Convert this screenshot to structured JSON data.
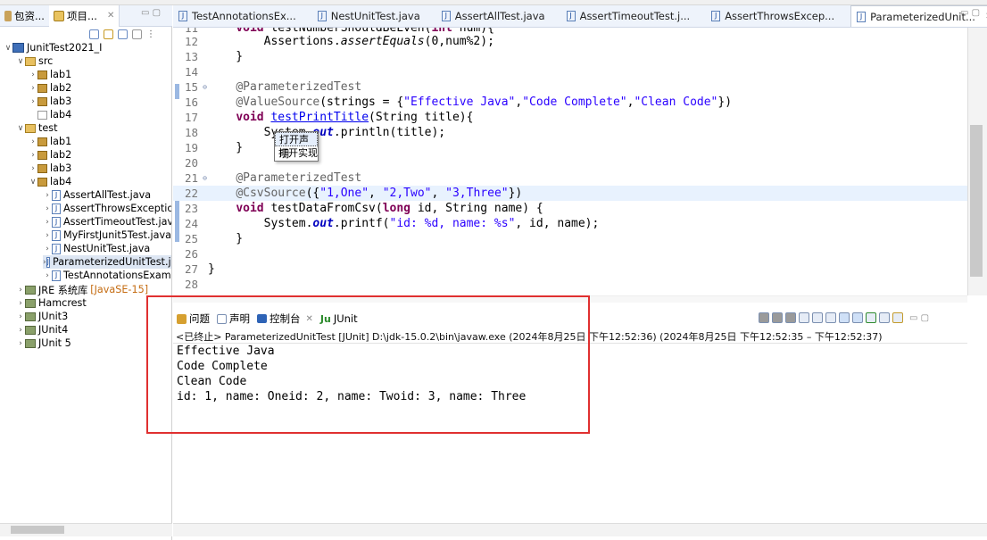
{
  "left_panel": {
    "tabs": [
      {
        "label": "包资...",
        "active": false
      },
      {
        "label": "项目...",
        "active": true
      }
    ],
    "tree": [
      {
        "label": "JunitTest2021_I",
        "type": "project",
        "expanded": true
      },
      {
        "label": "src",
        "type": "source-folder",
        "expanded": true
      },
      {
        "label": "lab1",
        "type": "package"
      },
      {
        "label": "lab2",
        "type": "package"
      },
      {
        "label": "lab3",
        "type": "package"
      },
      {
        "label": "lab4",
        "type": "package-empty"
      },
      {
        "label": "test",
        "type": "source-folder",
        "expanded": true
      },
      {
        "label": "lab1",
        "type": "package"
      },
      {
        "label": "lab2",
        "type": "package"
      },
      {
        "label": "lab3",
        "type": "package"
      },
      {
        "label": "lab4",
        "type": "package",
        "expanded": true
      },
      {
        "label": "AssertAllTest.java",
        "type": "java-file"
      },
      {
        "label": "AssertThrowsExceptionTest.java",
        "type": "java-file"
      },
      {
        "label": "AssertTimeoutTest.java",
        "type": "java-file"
      },
      {
        "label": "MyFirstJunit5Test.java",
        "type": "java-file"
      },
      {
        "label": "NestUnitTest.java",
        "type": "java-file"
      },
      {
        "label": "ParameterizedUnitTest.java",
        "type": "java-file",
        "selected": true
      },
      {
        "label": "TestAnnotationsExample.java",
        "type": "java-file"
      },
      {
        "label": "JRE 系统库",
        "suffix": "[JavaSE-15]",
        "type": "library"
      },
      {
        "label": "Hamcrest",
        "type": "library"
      },
      {
        "label": "JUnit3",
        "type": "library"
      },
      {
        "label": "JUnit4",
        "type": "library"
      },
      {
        "label": "JUnit 5",
        "type": "library"
      }
    ]
  },
  "editor": {
    "tabs": [
      {
        "label": "TestAnnotationsEx...",
        "active": false
      },
      {
        "label": "NestUnitTest.java",
        "active": false
      },
      {
        "label": "AssertAllTest.java",
        "active": false
      },
      {
        "label": "AssertTimeoutTest.j...",
        "active": false
      },
      {
        "label": "AssertThrowsExcep...",
        "active": false
      },
      {
        "label": "ParameterizedUnit...",
        "active": true
      }
    ],
    "lines": [
      {
        "n": "11",
        "text": "    void testNumberShouldBeEven(int num){"
      },
      {
        "n": "12",
        "text": "        Assertions.assertEquals(0,num%2);"
      },
      {
        "n": "13",
        "text": "    }"
      },
      {
        "n": "14",
        "text": ""
      },
      {
        "n": "15",
        "text": "    @ParameterizedTest"
      },
      {
        "n": "16",
        "text": "    @ValueSource(strings = {\"Effective Java\",\"Code Complete\",\"Clean Code\"})"
      },
      {
        "n": "17",
        "text": "    void testPrintTitle(String title){"
      },
      {
        "n": "18",
        "text": "        System.out.println(title);"
      },
      {
        "n": "19",
        "text": "    }"
      },
      {
        "n": "20",
        "text": ""
      },
      {
        "n": "21",
        "text": "    @ParameterizedTest"
      },
      {
        "n": "22",
        "text": "    @CsvSource({\"1,One\", \"2,Two\", \"3,Three\"})"
      },
      {
        "n": "23",
        "text": "    void testDataFromCsv(long id, String name) {"
      },
      {
        "n": "24",
        "text": "        System.out.printf(\"id: %d, name: %s\", id, name);"
      },
      {
        "n": "25",
        "text": "    }"
      },
      {
        "n": "26",
        "text": ""
      },
      {
        "n": "27",
        "text": "}"
      },
      {
        "n": "28",
        "text": ""
      }
    ],
    "popup": {
      "items": [
        "打开声明",
        "打开实现"
      ]
    }
  },
  "console": {
    "tabs": [
      {
        "label": "问题",
        "active": false
      },
      {
        "label": "声明",
        "active": false
      },
      {
        "label": "控制台",
        "active": true
      },
      {
        "label": "JUnit",
        "active": false
      }
    ],
    "status": "<已终止> ParameterizedUnitTest [JUnit] D:\\jdk-15.0.2\\bin\\javaw.exe  (2024年8月25日 下午12:52:36)   (2024年8月25日 下午12:52:35 – 下午12:52:37)",
    "output": [
      "Effective Java",
      "Code Complete",
      "Clean Code",
      "id: 1, name: Oneid: 2, name: Twoid: 3, name: Three"
    ]
  },
  "colors": {
    "keyword": "#7f0055",
    "string": "#2a00ff",
    "annotation": "#646464",
    "highlight_box": "#e03030"
  }
}
